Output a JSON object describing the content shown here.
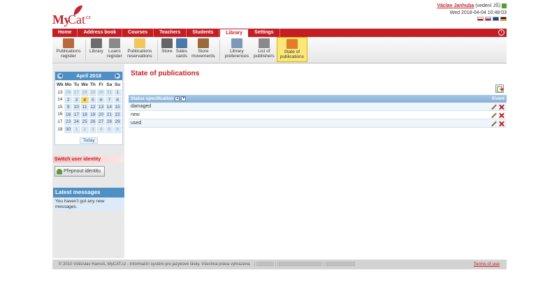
{
  "app": {
    "logo_my": "My",
    "logo_cat": "Cat",
    "logo_cz": ".cz"
  },
  "user": {
    "name": "Václav Janhuba",
    "role": "(vedení JŠ)",
    "datetime": "Wed 2018-04-04 10:48:03"
  },
  "tabs": [
    {
      "label": "Home",
      "active": false
    },
    {
      "label": "Address book",
      "active": false
    },
    {
      "label": "Courses",
      "active": false
    },
    {
      "label": "Teachers",
      "active": false
    },
    {
      "label": "Students",
      "active": false
    },
    {
      "label": "Library",
      "active": true
    },
    {
      "label": "Settings",
      "active": false
    }
  ],
  "toolbar": [
    {
      "label": "Publications register",
      "icon": "cassette-icon",
      "color": "#b86a3a"
    },
    {
      "label": "Library",
      "icon": "bookshelf-icon",
      "color": "#6d6d6d"
    },
    {
      "label": "Loans register",
      "icon": "books-icon",
      "color": "#8a8a8a"
    },
    {
      "label": "Publications reservations",
      "icon": "folder-icon",
      "color": "#f0c75a"
    },
    {
      "label": "Store",
      "icon": "store-icon",
      "color": "#666"
    },
    {
      "label": "Sales cards",
      "icon": "cards-icon",
      "color": "#4a7aa8"
    },
    {
      "label": "Store movements",
      "icon": "hammer-icon",
      "color": "#9a6a3a"
    },
    {
      "label": "Library preferences",
      "icon": "preferences-icon",
      "color": "#7a9ab8"
    },
    {
      "label": "List of publishers",
      "icon": "building-icon",
      "color": "#8a8a8a"
    },
    {
      "label": "State of publications",
      "icon": "arrow-icon",
      "color": "#e67c2a",
      "active": true
    }
  ],
  "calendar": {
    "month": "April 2018",
    "headers": [
      "Wk",
      "Mo",
      "Tu",
      "We",
      "Th",
      "Fr",
      "Sa",
      "Su"
    ],
    "weeks": [
      {
        "wk": "13",
        "days": [
          "26",
          "27",
          "28",
          "29",
          "30",
          "31",
          "1"
        ],
        "out": [
          true,
          true,
          true,
          true,
          true,
          true,
          false
        ]
      },
      {
        "wk": "14",
        "days": [
          "2",
          "3",
          "4",
          "5",
          "6",
          "7",
          "8"
        ],
        "out": [
          false,
          false,
          false,
          false,
          false,
          false,
          false
        ]
      },
      {
        "wk": "15",
        "days": [
          "9",
          "10",
          "11",
          "12",
          "13",
          "14",
          "15"
        ],
        "out": [
          false,
          false,
          false,
          false,
          false,
          false,
          false
        ]
      },
      {
        "wk": "16",
        "days": [
          "16",
          "17",
          "18",
          "19",
          "20",
          "21",
          "22"
        ],
        "out": [
          false,
          false,
          false,
          false,
          false,
          false,
          false
        ]
      },
      {
        "wk": "17",
        "days": [
          "23",
          "24",
          "25",
          "26",
          "27",
          "28",
          "29"
        ],
        "out": [
          false,
          false,
          false,
          false,
          false,
          false,
          false
        ]
      },
      {
        "wk": "18",
        "days": [
          "30",
          "1",
          "2",
          "3",
          "4",
          "5",
          "6"
        ],
        "out": [
          false,
          true,
          true,
          true,
          true,
          true,
          true
        ]
      }
    ],
    "today_day": "4",
    "today_label": "Today"
  },
  "sidebar": {
    "switch_title": "Switch user identity",
    "switch_button": "Přepnout identitu",
    "messages_title": "Latest messages",
    "messages_body": "You haven't got any new messages."
  },
  "main": {
    "title": "State of publications",
    "col_status": "Status specification",
    "col_event": "Event",
    "rows": [
      "damaged",
      "new",
      "used"
    ]
  },
  "footer": {
    "copyright": "© 2010 Vítězslav Harnoš, MyCAT.cz - Informační systém pro jazykové školy. Všechna práva vyhrazena",
    "terms": "Terms of use"
  },
  "colors": {
    "brand": "#c41e24",
    "accent_blue": "#4f8fc4",
    "highlight": "#fbe77a"
  }
}
